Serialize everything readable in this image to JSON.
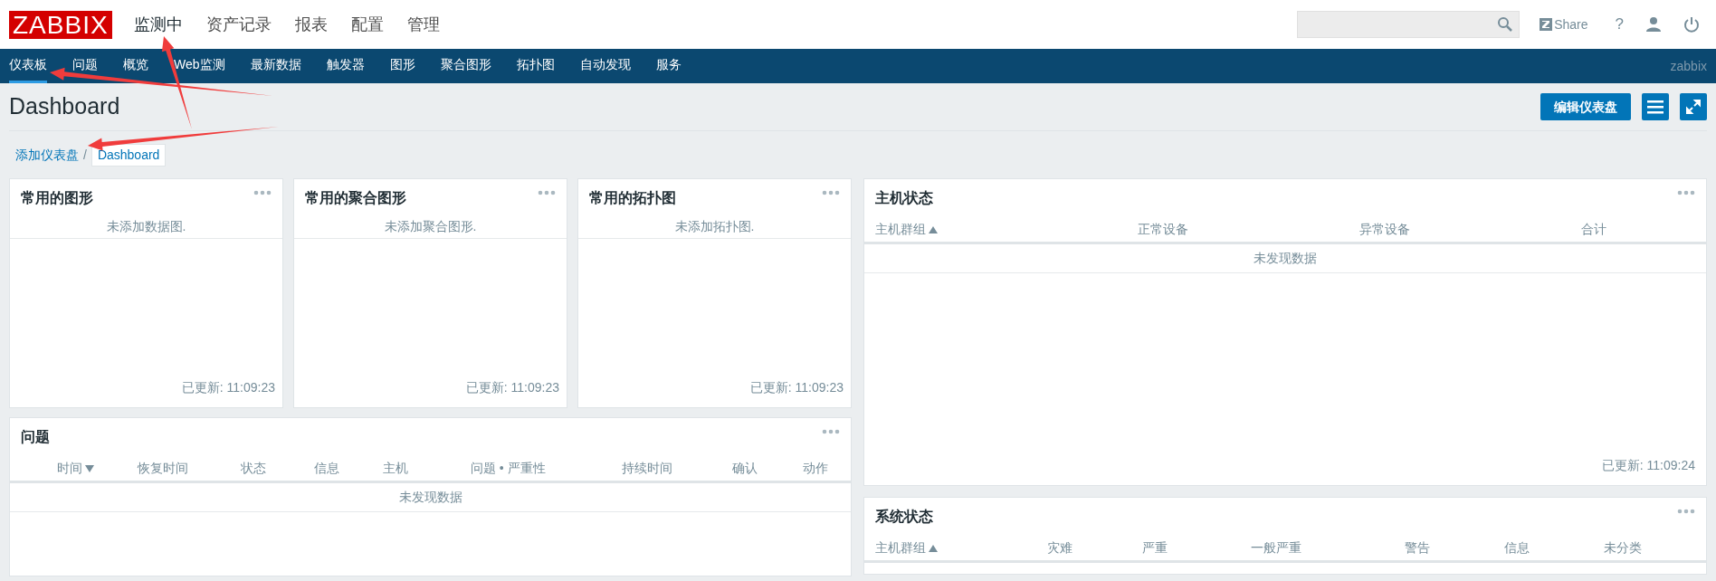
{
  "header": {
    "logo": "ZABBIX",
    "main_menu": [
      {
        "label": "监测中",
        "selected": true
      },
      {
        "label": "资产记录",
        "selected": false
      },
      {
        "label": "报表",
        "selected": false
      },
      {
        "label": "配置",
        "selected": false
      },
      {
        "label": "管理",
        "selected": false
      }
    ],
    "share": "Share",
    "help": "?"
  },
  "sub_menu": {
    "items": [
      {
        "label": "仪表板",
        "selected": true
      },
      {
        "label": "问题",
        "selected": false
      },
      {
        "label": "概览",
        "selected": false
      },
      {
        "label": "Web监测",
        "selected": false
      },
      {
        "label": "最新数据",
        "selected": false
      },
      {
        "label": "触发器",
        "selected": false
      },
      {
        "label": "图形",
        "selected": false
      },
      {
        "label": "聚合图形",
        "selected": false
      },
      {
        "label": "拓扑图",
        "selected": false
      },
      {
        "label": "自动发现",
        "selected": false
      },
      {
        "label": "服务",
        "selected": false
      }
    ],
    "user": "zabbix"
  },
  "page": {
    "title": "Dashboard",
    "edit_button": "编辑仪表盘"
  },
  "breadcrumb": [
    {
      "label": "添加仪表盘",
      "selected": false
    },
    {
      "label": "Dashboard",
      "selected": true
    }
  ],
  "breadcrumb_separator": "/",
  "widgets_left_top": [
    {
      "title": "常用的图形",
      "message": "未添加数据图.",
      "updated": "已更新: 11:09:23"
    },
    {
      "title": "常用的聚合图形",
      "message": "未添加聚合图形.",
      "updated": "已更新: 11:09:23"
    },
    {
      "title": "常用的拓扑图",
      "message": "未添加拓扑图.",
      "updated": "已更新: 11:09:23"
    }
  ],
  "problems_widget": {
    "title": "问题",
    "columns": [
      {
        "label": "时间",
        "sorted_descending": true
      },
      {
        "label": "恢复时间"
      },
      {
        "label": "状态"
      },
      {
        "label": "信息"
      },
      {
        "label": "主机"
      },
      {
        "label": "问题 • 严重性"
      },
      {
        "label": "持续时间"
      },
      {
        "label": "确认"
      },
      {
        "label": "动作"
      }
    ],
    "empty": "未发现数据"
  },
  "host_status_widget": {
    "title": "主机状态",
    "columns": [
      {
        "label": "主机群组",
        "sorted_ascending": true
      },
      {
        "label": "正常设备"
      },
      {
        "label": "异常设备"
      },
      {
        "label": "合计"
      }
    ],
    "empty": "未发现数据",
    "updated": "已更新: 11:09:24"
  },
  "system_status_widget": {
    "title": "系统状态",
    "columns": [
      {
        "label": "主机群组",
        "sorted_ascending": true
      },
      {
        "label": "灾难"
      },
      {
        "label": "严重"
      },
      {
        "label": "一般严重"
      },
      {
        "label": "警告"
      },
      {
        "label": "信息"
      },
      {
        "label": "未分类"
      }
    ]
  },
  "annotations": [
    {
      "kind": "arrow"
    },
    {
      "kind": "arrow"
    },
    {
      "kind": "arrow"
    }
  ]
}
